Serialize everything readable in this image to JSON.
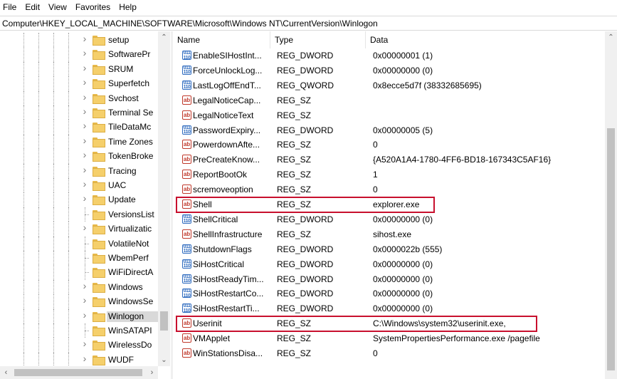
{
  "menu": [
    "File",
    "Edit",
    "View",
    "Favorites",
    "Help"
  ],
  "address": "Computer\\HKEY_LOCAL_MACHINE\\SOFTWARE\\Microsoft\\Windows NT\\CurrentVersion\\Winlogon",
  "tree": {
    "items": [
      {
        "label": "setup",
        "expandable": true
      },
      {
        "label": "SoftwarePr",
        "expandable": true
      },
      {
        "label": "SRUM",
        "expandable": true
      },
      {
        "label": "Superfetch",
        "expandable": true
      },
      {
        "label": "Svchost",
        "expandable": true
      },
      {
        "label": "Terminal Se",
        "expandable": true
      },
      {
        "label": "TileDataMc",
        "expandable": true
      },
      {
        "label": "Time Zones",
        "expandable": true
      },
      {
        "label": "TokenBroke",
        "expandable": true
      },
      {
        "label": "Tracing",
        "expandable": true
      },
      {
        "label": "UAC",
        "expandable": true
      },
      {
        "label": "Update",
        "expandable": true
      },
      {
        "label": "VersionsList",
        "expandable": false
      },
      {
        "label": "Virtualizatic",
        "expandable": true
      },
      {
        "label": "VolatileNot",
        "expandable": false
      },
      {
        "label": "WbemPerf",
        "expandable": false
      },
      {
        "label": "WiFiDirectA",
        "expandable": false
      },
      {
        "label": "Windows",
        "expandable": true
      },
      {
        "label": "WindowsSe",
        "expandable": true
      },
      {
        "label": "Winlogon",
        "expandable": true,
        "selected": true
      },
      {
        "label": "WinSATAPI",
        "expandable": false
      },
      {
        "label": "WirelessDo",
        "expandable": true
      },
      {
        "label": "WUDF",
        "expandable": true
      }
    ]
  },
  "columns": {
    "name": "Name",
    "type": "Type",
    "data": "Data"
  },
  "values": [
    {
      "icon": "bin",
      "name": "EnableSIHostInt...",
      "type": "REG_DWORD",
      "data": "0x00000001 (1)"
    },
    {
      "icon": "bin",
      "name": "ForceUnlockLog...",
      "type": "REG_DWORD",
      "data": "0x00000000 (0)"
    },
    {
      "icon": "bin",
      "name": "LastLogOffEndT...",
      "type": "REG_QWORD",
      "data": "0x8ecce5d7f (38332685695)"
    },
    {
      "icon": "sz",
      "name": "LegalNoticeCap...",
      "type": "REG_SZ",
      "data": ""
    },
    {
      "icon": "sz",
      "name": "LegalNoticeText",
      "type": "REG_SZ",
      "data": ""
    },
    {
      "icon": "bin",
      "name": "PasswordExpiry...",
      "type": "REG_DWORD",
      "data": "0x00000005 (5)"
    },
    {
      "icon": "sz",
      "name": "PowerdownAfte...",
      "type": "REG_SZ",
      "data": "0"
    },
    {
      "icon": "sz",
      "name": "PreCreateKnow...",
      "type": "REG_SZ",
      "data": "{A520A1A4-1780-4FF6-BD18-167343C5AF16}"
    },
    {
      "icon": "sz",
      "name": "ReportBootOk",
      "type": "REG_SZ",
      "data": "1"
    },
    {
      "icon": "sz",
      "name": "scremoveoption",
      "type": "REG_SZ",
      "data": "0"
    },
    {
      "icon": "sz",
      "name": "Shell",
      "type": "REG_SZ",
      "data": "explorer.exe",
      "highlighted": true
    },
    {
      "icon": "bin",
      "name": "ShellCritical",
      "type": "REG_DWORD",
      "data": "0x00000000 (0)"
    },
    {
      "icon": "sz",
      "name": "ShellInfrastructure",
      "type": "REG_SZ",
      "data": "sihost.exe"
    },
    {
      "icon": "bin",
      "name": "ShutdownFlags",
      "type": "REG_DWORD",
      "data": "0x0000022b (555)"
    },
    {
      "icon": "bin",
      "name": "SiHostCritical",
      "type": "REG_DWORD",
      "data": "0x00000000 (0)"
    },
    {
      "icon": "bin",
      "name": "SiHostReadyTim...",
      "type": "REG_DWORD",
      "data": "0x00000000 (0)"
    },
    {
      "icon": "bin",
      "name": "SiHostRestartCo...",
      "type": "REG_DWORD",
      "data": "0x00000000 (0)"
    },
    {
      "icon": "bin",
      "name": "SiHostRestartTi...",
      "type": "REG_DWORD",
      "data": "0x00000000 (0)"
    },
    {
      "icon": "sz",
      "name": "Userinit",
      "type": "REG_SZ",
      "data": "C:\\Windows\\system32\\userinit.exe,",
      "highlighted": true
    },
    {
      "icon": "sz",
      "name": "VMApplet",
      "type": "REG_SZ",
      "data": "SystemPropertiesPerformance.exe /pagefile"
    },
    {
      "icon": "sz",
      "name": "WinStationsDisa...",
      "type": "REG_SZ",
      "data": "0"
    }
  ],
  "colors": {
    "highlight_border": "#c8102e",
    "selected_bg": "#d9d9d9"
  },
  "icons": {
    "sz_glyph": "ab",
    "bin_glyph": "011\n110"
  }
}
